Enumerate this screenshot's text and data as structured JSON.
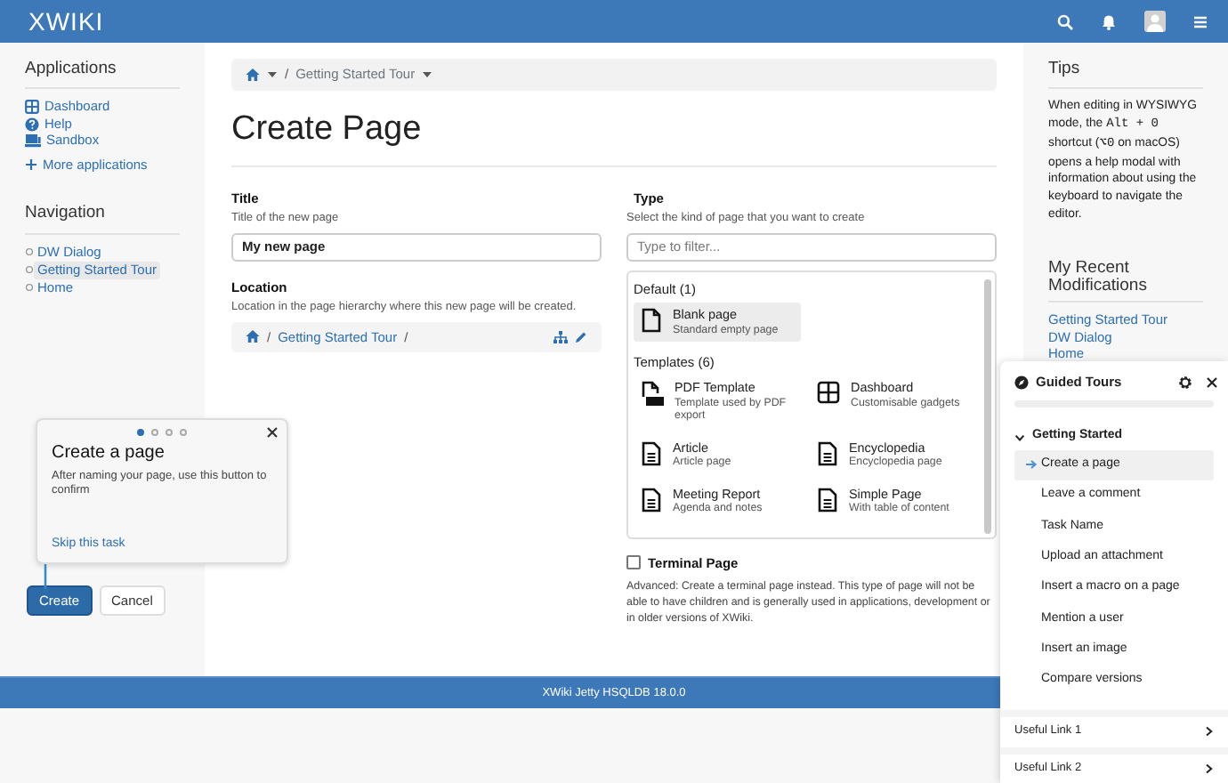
{
  "navbar": {
    "logo": "XWIKI"
  },
  "applications": {
    "heading": "Applications",
    "items": [
      {
        "label": "Dashboard"
      },
      {
        "label": "Help"
      },
      {
        "label": "Sandbox"
      }
    ],
    "more": "More applications"
  },
  "navigation": {
    "heading": "Navigation",
    "items": [
      {
        "label": "DW Dialog",
        "selected": false
      },
      {
        "label": "Getting Started Tour",
        "selected": true
      },
      {
        "label": "Home",
        "selected": false
      }
    ]
  },
  "breadcrumb": [
    {
      "kind": "sep",
      "text": "/"
    },
    {
      "kind": "link",
      "text": "Getting Started Tour"
    }
  ],
  "page_title": "Create Page",
  "title_field": {
    "label": "Title",
    "hint": "Title of the new page",
    "value": "My new page"
  },
  "location": {
    "label": "Location",
    "hint": "Location in the page hierarchy where this new page will be created.",
    "path": [
      {
        "kind": "sep",
        "text": "/"
      },
      {
        "kind": "link",
        "text": "Getting Started Tour"
      },
      {
        "kind": "sep",
        "text": "/"
      }
    ]
  },
  "type": {
    "label": "Type",
    "hint": "Select the kind of page that you want to create",
    "placeholder": "Type to filter...",
    "groups": [
      {
        "heading": "Default (1)",
        "items": [
          {
            "kind": "blank",
            "name": "Blank page",
            "description": "Standard empty page",
            "selected": true
          }
        ]
      },
      {
        "heading": "Templates (6)",
        "items": [
          {
            "kind": "pdf",
            "name": "PDF Template",
            "description": "Template used by PDF export",
            "selected": false
          },
          {
            "kind": "grid",
            "name": "Dashboard",
            "description": "Customisable gadgets",
            "selected": false
          },
          {
            "kind": "document",
            "name": "Article",
            "description": "Article page",
            "selected": false
          },
          {
            "kind": "document",
            "name": "Encyclopedia",
            "description": "Encyclopedia page",
            "selected": false
          },
          {
            "kind": "document",
            "name": "Meeting Report",
            "description": "Agenda and notes",
            "selected": false
          },
          {
            "kind": "document",
            "name": "Simple Page",
            "description": "With table of content",
            "selected": false
          }
        ]
      }
    ]
  },
  "terminal": {
    "label": "Terminal Page",
    "checked": false,
    "description": "Advanced: Create a terminal page instead. This type of page will not be able to have children and is generally used in applications, development or in older versions of XWiki."
  },
  "buttons": {
    "create": "Create",
    "cancel": "Cancel"
  },
  "tips": {
    "heading": "Tips",
    "text": [
      {
        "kind": "plain",
        "text": "When editing in WYSIWYG mode, the "
      },
      {
        "kind": "code",
        "text": "Alt + 0"
      },
      {
        "kind": "plain",
        "text": " shortcut ("
      },
      {
        "kind": "code",
        "text": "⌥0"
      },
      {
        "kind": "plain",
        "text": " on macOS) opens a help modal with information about using the keyboard to navigate the editor."
      }
    ]
  },
  "recent": {
    "heading": "My Recent Modifications",
    "items": [
      "Getting Started Tour",
      "DW Dialog",
      "Home"
    ]
  },
  "footer": "XWiki Jetty HSQLDB 18.0.0",
  "popover": {
    "steps": [
      {
        "selected": true
      },
      {
        "selected": false
      },
      {
        "selected": false
      },
      {
        "selected": false
      }
    ],
    "title": "Create a page",
    "text": "After naming your page, use this button to confirm",
    "link": "Skip this task"
  },
  "guided_tours": {
    "title": "Guided Tours",
    "section": {
      "title": "Getting Started",
      "expanded": true,
      "tasks": [
        {
          "label": "Create a page",
          "selected": true
        },
        {
          "label": "Leave a comment",
          "selected": false
        },
        {
          "label": "Task Name",
          "selected": false
        },
        {
          "label": "Upload an attachment",
          "selected": false
        },
        {
          "label": "Insert a macro on a page",
          "selected": false
        },
        {
          "label": "Mention a user",
          "selected": false
        },
        {
          "label": "Insert an image",
          "selected": false
        },
        {
          "label": "Compare versions",
          "selected": false
        }
      ]
    },
    "links": [
      "Useful Link 1",
      "Useful Link 2"
    ]
  }
}
